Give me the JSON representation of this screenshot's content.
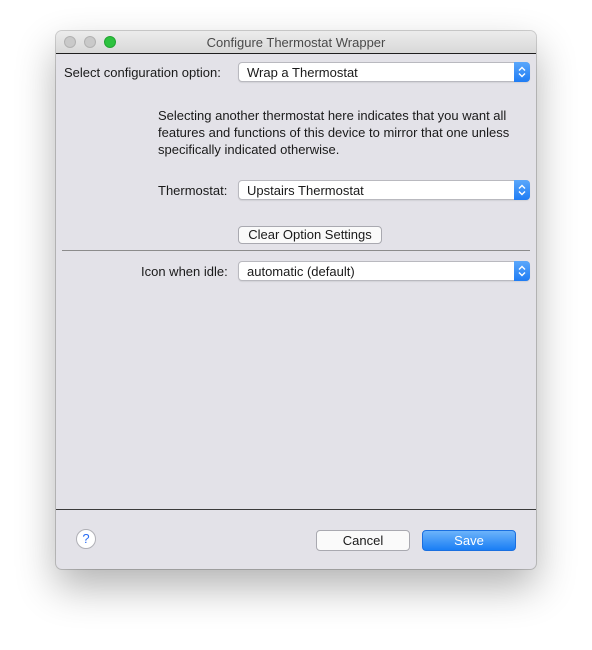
{
  "window": {
    "title": "Configure Thermostat Wrapper"
  },
  "config_option": {
    "label": "Select configuration option:",
    "value": "Wrap a Thermostat"
  },
  "description": "Selecting another thermostat here indicates that you want all features and functions of this device to mirror that one unless specifically indicated otherwise.",
  "thermostat": {
    "label": "Thermostat:",
    "value": "Upstairs Thermostat"
  },
  "clear_button": {
    "label": "Clear Option Settings"
  },
  "icon_idle": {
    "label": "Icon when idle:",
    "value": "automatic (default)"
  },
  "footer": {
    "help_label": "?",
    "cancel_label": "Cancel",
    "save_label": "Save"
  },
  "colors": {
    "accent": "#1f7cf4",
    "window_bg": "#e3e2e8"
  },
  "icons": {
    "popup_arrows": "updown-chevron-icon",
    "help": "question-mark-icon"
  }
}
